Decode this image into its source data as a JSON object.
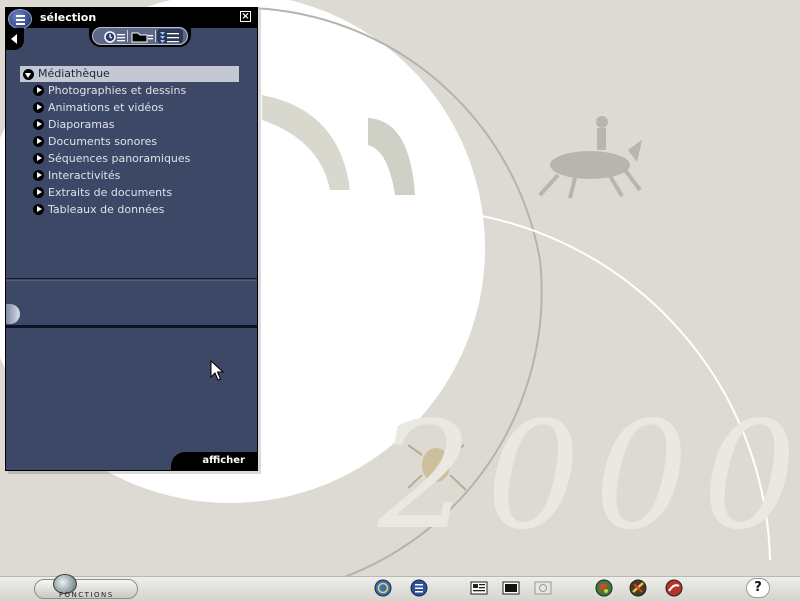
{
  "background": {
    "year_text": "2000",
    "colors": {
      "desktop": "#dcdad3",
      "disc": "#ffffff",
      "year": "#e9e8e2"
    }
  },
  "panel": {
    "title": "sélection",
    "close_symbol": "×",
    "colors": {
      "body": "#3d4766",
      "bar": "#000000",
      "selected_row": "#c5c8d2"
    },
    "toolbar_icons": [
      "history-icon",
      "folder-icon",
      "list-tree-icon"
    ],
    "tree": {
      "root": {
        "label": "Médiathèque",
        "expanded": true
      },
      "items": [
        {
          "label": "Photographies et dessins"
        },
        {
          "label": "Animations et vidéos"
        },
        {
          "label": "Diaporamas"
        },
        {
          "label": "Documents sonores"
        },
        {
          "label": "Séquences panoramiques"
        },
        {
          "label": "Interactivités"
        },
        {
          "label": "Extraits de documents"
        },
        {
          "label": "Tableaux de données"
        }
      ]
    },
    "afficher_label": "afficher"
  },
  "taskbar": {
    "fonctions_label": "FONCTIONS",
    "icons": [
      "history-icon",
      "list-icon",
      "article-icon",
      "screen-icon",
      "gallery-icon",
      "atlas-icon",
      "tools-icon",
      "link-icon"
    ],
    "help_label": "?"
  }
}
